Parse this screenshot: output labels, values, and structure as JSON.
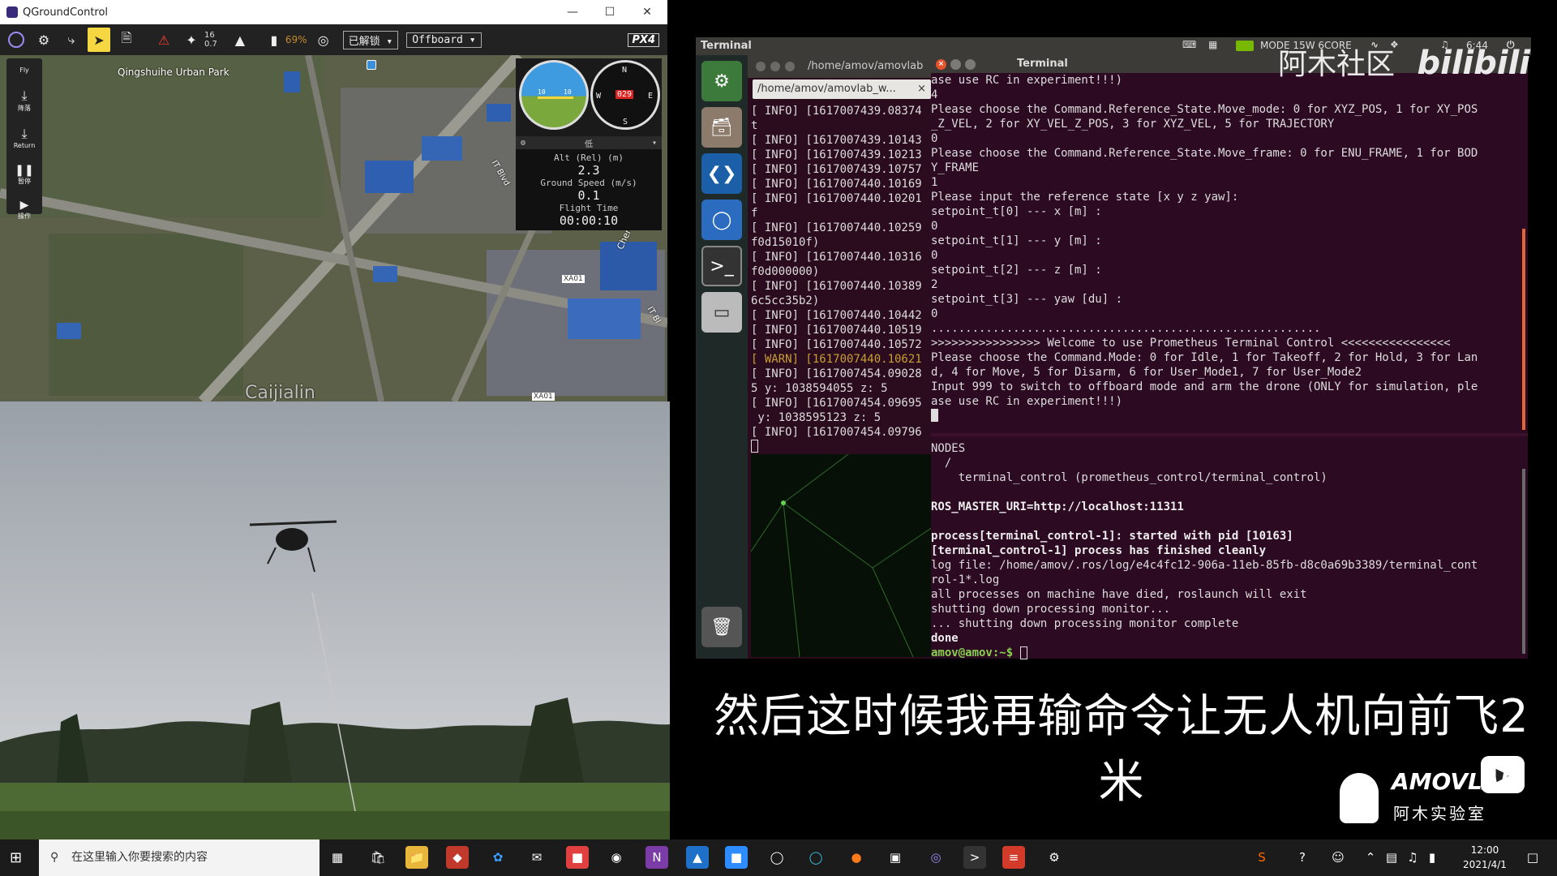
{
  "qgc": {
    "window_title": "QGroundControl",
    "toolbar": {
      "satellite_count": "16",
      "hdop": "0.7",
      "battery": "69%",
      "lock_state": "已解锁",
      "flight_mode": "Offboard",
      "logo": "PX4"
    },
    "fly_tools": [
      {
        "icon": "fly-icon",
        "label": "Fly"
      },
      {
        "icon": "land-icon",
        "label": "降落"
      },
      {
        "icon": "return-icon",
        "label": "Return"
      },
      {
        "icon": "pause-icon",
        "label": "暂停"
      },
      {
        "icon": "action-icon",
        "label": "操作"
      }
    ],
    "map": {
      "labels": [
        "Qingshuihe Urban Park",
        "IT Blvd",
        "Chenghu",
        "IT Bl",
        "XA01",
        "XA01",
        "Caijialin"
      ]
    },
    "instrument": {
      "gear_value": "低",
      "attitude_ticks": [
        "10",
        "10"
      ],
      "compass_heading": "029",
      "compass_letters": [
        "N",
        "E",
        "S",
        "W"
      ],
      "alt_label": "Alt (Rel) (m)",
      "alt_value": "2.3",
      "speed_label": "Ground Speed (m/s)",
      "speed_value": "0.1",
      "time_label": "Flight Time",
      "time_value": "00:00:10"
    }
  },
  "ubuntu": {
    "topbar_title": "Terminal",
    "topbar_status": "MODE 15W 6CORE",
    "topbar_time": "6:44",
    "bg_terminal": {
      "title": "/home/amov/amovlab",
      "tab": "/home/amov/amovlab_w...",
      "lines": [
        {
          "t": "[ INFO] [1617007439.08374",
          "c": ""
        },
        {
          "t": "t",
          "c": ""
        },
        {
          "t": "[ INFO] [1617007439.10143",
          "c": ""
        },
        {
          "t": "[ INFO] [1617007439.10213",
          "c": ""
        },
        {
          "t": "[ INFO] [1617007439.10757",
          "c": ""
        },
        {
          "t": "[ INFO] [1617007440.10169",
          "c": ""
        },
        {
          "t": "[ INFO] [1617007440.10201",
          "c": ""
        },
        {
          "t": "f",
          "c": ""
        },
        {
          "t": "[ INFO] [1617007440.10259",
          "c": ""
        },
        {
          "t": "f0d15010f)",
          "c": ""
        },
        {
          "t": "[ INFO] [1617007440.10316",
          "c": ""
        },
        {
          "t": "f0d000000)",
          "c": ""
        },
        {
          "t": "[ INFO] [1617007440.10389",
          "c": ""
        },
        {
          "t": "6c5cc35b2)",
          "c": ""
        },
        {
          "t": "[ INFO] [1617007440.10442",
          "c": ""
        },
        {
          "t": "[ INFO] [1617007440.10519",
          "c": ""
        },
        {
          "t": "[ INFO] [1617007440.10572",
          "c": ""
        },
        {
          "t": "[ WARN] [1617007440.10621",
          "c": "warn"
        },
        {
          "t": "[ INFO] [1617007454.09028",
          "c": ""
        },
        {
          "t": "5 y: 1038594055 z: 5",
          "c": ""
        },
        {
          "t": "[ INFO] [1617007454.09695",
          "c": ""
        },
        {
          "t": " y: 1038595123 z: 5",
          "c": ""
        },
        {
          "t": "[ INFO] [1617007454.09796",
          "c": ""
        }
      ]
    },
    "fg_terminal": {
      "title": "Terminal",
      "upper_lines": [
        "ase use RC in experiment!!!)",
        "4",
        "Please choose the Command.Reference_State.Move_mode: 0 for XYZ_POS, 1 for XY_POS",
        "_Z_VEL, 2 for XY_VEL_Z_POS, 3 for XYZ_VEL, 5 for TRAJECTORY",
        "0",
        "Please choose the Command.Reference_State.Move_frame: 0 for ENU_FRAME, 1 for BOD",
        "Y_FRAME",
        "1",
        "Please input the reference state [x y z yaw]:",
        "setpoint_t[0] --- x [m] :",
        "0",
        "setpoint_t[1] --- y [m] :",
        "0",
        "setpoint_t[2] --- z [m] :",
        "2",
        "setpoint_t[3] --- yaw [du] :",
        "0",
        ".........................................................",
        ">>>>>>>>>>>>>>>> Welcome to use Prometheus Terminal Control <<<<<<<<<<<<<<<<",
        "Please choose the Command.Mode: 0 for Idle, 1 for Takeoff, 2 for Hold, 3 for Lan",
        "d, 4 for Move, 5 for Disarm, 6 for User_Mode1, 7 for User_Mode2",
        "Input 999 to switch to offboard mode and arm the drone (ONLY for simulation, ple",
        "ase use RC in experiment!!!)"
      ],
      "lower_lines": [
        {
          "t": "NODES",
          "c": ""
        },
        {
          "t": "  /",
          "c": ""
        },
        {
          "t": "    terminal_control (prometheus_control/terminal_control)",
          "c": ""
        },
        {
          "t": "",
          "c": ""
        },
        {
          "t": "ROS_MASTER_URI=http://localhost:11311",
          "c": "b"
        },
        {
          "t": "",
          "c": ""
        },
        {
          "t": "process[terminal_control-1]: started with pid [10163]",
          "c": "b"
        },
        {
          "t": "[terminal_control-1] process has finished cleanly",
          "c": "b"
        },
        {
          "t": "log file: /home/amov/.ros/log/e4c4fc12-906a-11eb-85fb-d8c0a69b3389/terminal_cont",
          "c": ""
        },
        {
          "t": "rol-1*.log",
          "c": ""
        },
        {
          "t": "all processes on machine have died, roslaunch will exit",
          "c": ""
        },
        {
          "t": "shutting down processing monitor...",
          "c": ""
        },
        {
          "t": "... shutting down processing monitor complete",
          "c": ""
        },
        {
          "t": "done",
          "c": "b"
        }
      ],
      "prompt": "amov@amov:~$"
    }
  },
  "overlay": {
    "subtitle": "然后这时候我再输命令让无人机向前飞2米",
    "watermark_cn": "阿木社区",
    "watermark_bili": "bilibili",
    "brand": "AMOVLAB",
    "brand_cn": "阿木实验室"
  },
  "taskbar": {
    "search_placeholder": "在这里输入你要搜索的内容",
    "time": "12:00",
    "date": "2021/4/1"
  }
}
